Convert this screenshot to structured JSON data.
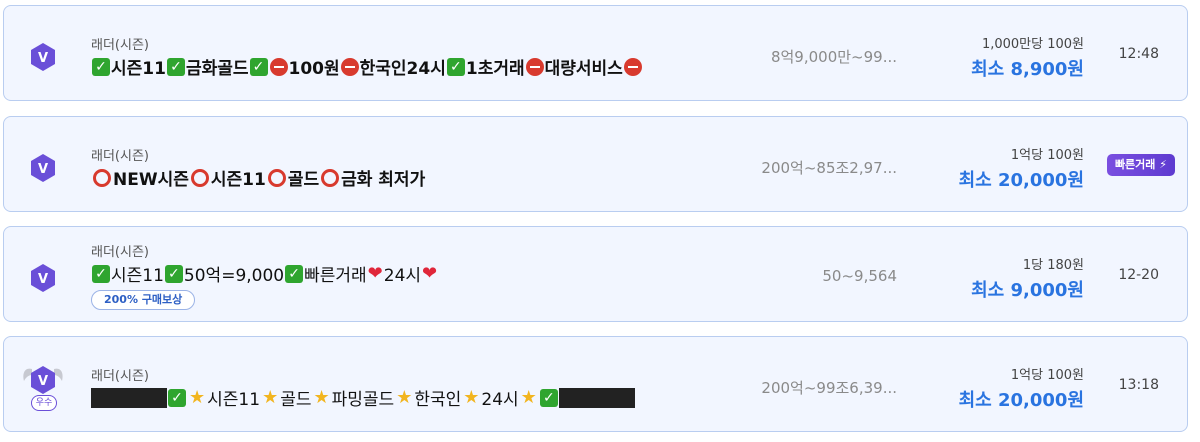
{
  "listings": [
    {
      "category": "래더(시즌)",
      "title_parts": [
        {
          "k": "ck"
        },
        {
          "k": "t",
          "v": "시즌11"
        },
        {
          "k": "ck"
        },
        {
          "k": "t",
          "v": "금화골드"
        },
        {
          "k": "ck"
        },
        {
          "k": "no"
        },
        {
          "k": "t",
          "v": "100원"
        },
        {
          "k": "no"
        },
        {
          "k": "t",
          "v": "한국인24시"
        },
        {
          "k": "ck"
        },
        {
          "k": "t",
          "v": "1초거래"
        },
        {
          "k": "no"
        },
        {
          "k": "t",
          "v": "대량서비스"
        },
        {
          "k": "no"
        }
      ],
      "range": "8억9,000만~99...",
      "unit_price": "1,000만당 100원",
      "min_price": "최소 8,900원",
      "time": "12:48"
    },
    {
      "category": "래더(시즌)",
      "title_parts": [
        {
          "k": "ring"
        },
        {
          "k": "t",
          "v": "NEW시즌"
        },
        {
          "k": "ring"
        },
        {
          "k": "t",
          "v": "시즌11"
        },
        {
          "k": "ring"
        },
        {
          "k": "t",
          "v": "골드"
        },
        {
          "k": "ring"
        },
        {
          "k": "t",
          "v": "금화 최저가"
        }
      ],
      "range": "200억~85조2,97...",
      "unit_price": "1억당 100원",
      "min_price": "최소 20,000원",
      "fast_label": "빠른거래"
    },
    {
      "category": "래더(시즌)",
      "title_parts": [
        {
          "k": "ck"
        },
        {
          "k": "t",
          "v": "시즌11"
        },
        {
          "k": "ck"
        },
        {
          "k": "t",
          "v": "50억=9,000"
        },
        {
          "k": "ck"
        },
        {
          "k": "t",
          "v": "빠른거래"
        },
        {
          "k": "heart"
        },
        {
          "k": "t",
          "v": "24시"
        },
        {
          "k": "heart"
        }
      ],
      "tag": "200% 구매보상",
      "range": "50~9,564",
      "unit_price": "1당 180원",
      "min_price": "최소 9,000원",
      "time": "12-20"
    },
    {
      "category": "래더(시즌)",
      "grade": "우수",
      "title_parts": [
        {
          "k": "redact"
        },
        {
          "k": "ck"
        },
        {
          "k": "star"
        },
        {
          "k": "t",
          "v": "시즌11"
        },
        {
          "k": "star"
        },
        {
          "k": "t",
          "v": "골드"
        },
        {
          "k": "star"
        },
        {
          "k": "t",
          "v": "파밍골드"
        },
        {
          "k": "star"
        },
        {
          "k": "t",
          "v": "한국인"
        },
        {
          "k": "star"
        },
        {
          "k": "t",
          "v": "24시"
        },
        {
          "k": "star"
        },
        {
          "k": "ck"
        },
        {
          "k": "redact"
        }
      ],
      "range": "200억~99조6,39...",
      "unit_price": "1억당 100원",
      "min_price": "최소 20,000원",
      "time": "13:18"
    }
  ],
  "colors": {
    "accent_price": "#2a74e0",
    "badge_purple": "#6a4fd8",
    "card_bg": "#f2f6ff"
  }
}
